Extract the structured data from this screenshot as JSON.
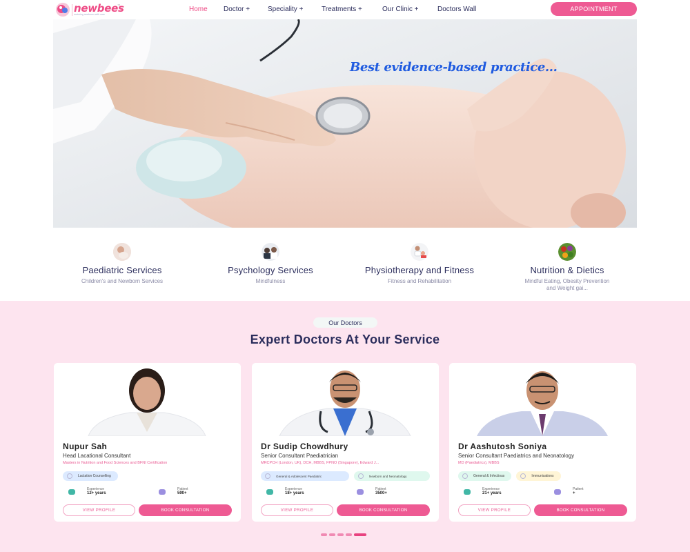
{
  "brand": {
    "name": "newbees",
    "tagline": "nurturing newborns with care",
    "trademark": "™",
    "accent_color": "#ee4c86"
  },
  "nav": {
    "items": [
      {
        "label": "Home",
        "active": true
      },
      {
        "label": "Doctor +"
      },
      {
        "label": "Speciality +"
      },
      {
        "label": "Treatments +"
      },
      {
        "label": "Our Clinic +"
      },
      {
        "label": "Doctors Wall"
      }
    ],
    "cta_label": "APPOINTMENT"
  },
  "hero": {
    "headline": "Best evidence-based practice..."
  },
  "services": [
    {
      "title": "Paediatric Services",
      "subtitle": "Children's and Newborn Services",
      "icon": "mother-baby-icon"
    },
    {
      "title": "Psychology Services",
      "subtitle": "Mindfulness",
      "icon": "counselling-icon"
    },
    {
      "title": "Physiotherapy and Fitness",
      "subtitle": "Fitness and Rehabilitation",
      "icon": "physio-icon"
    },
    {
      "title": "Nutrition & Dietics",
      "subtitle": "Mindful Eating, Obesity Prevention and Weight gai...",
      "icon": "vegetables-icon"
    }
  ],
  "doctors_section": {
    "eyebrow": "Our Doctors",
    "title": "Expert Doctors At Your Service",
    "experience_label": "Experience",
    "patient_label": "Patient",
    "view_profile_label": "VIEW PROFILE",
    "book_label": "BOOK CONSULTATION",
    "doctors": [
      {
        "name": "Nupur Sah",
        "role": "Head Lacational Consultant",
        "qualifications": "Masters in Nutrition and Food Sciences and BFNI Certification",
        "tags": [
          {
            "label": "Lactation Counselling",
            "color": "blue"
          }
        ],
        "experience": "12+ years",
        "patients": "590+"
      },
      {
        "name": "Dr Sudip Chowdhury",
        "role": "Senior Consultant Paediatrician",
        "qualifications": "MRCPCH (London, UK), DCH, MBBS, FPNO (Singapore), Edward J...",
        "tags": [
          {
            "label": "General & Adolescent Paediatric",
            "color": "blue"
          },
          {
            "label": "Newborn and Neonatology",
            "color": "green"
          }
        ],
        "experience": "18+ years",
        "patients": "3500+"
      },
      {
        "name": "Dr Aashutosh Soniya",
        "role": "Senior Consultant Paediatrics and Neonatology",
        "qualifications": "MD (Paediatrics), MBBS",
        "tags": [
          {
            "label": "General & Infectious",
            "color": "green"
          },
          {
            "label": "Immunisations",
            "color": "yellow"
          }
        ],
        "experience": "21+ years",
        "patients": "+"
      }
    ]
  },
  "carousel": {
    "count": 5,
    "active_index": 4
  }
}
